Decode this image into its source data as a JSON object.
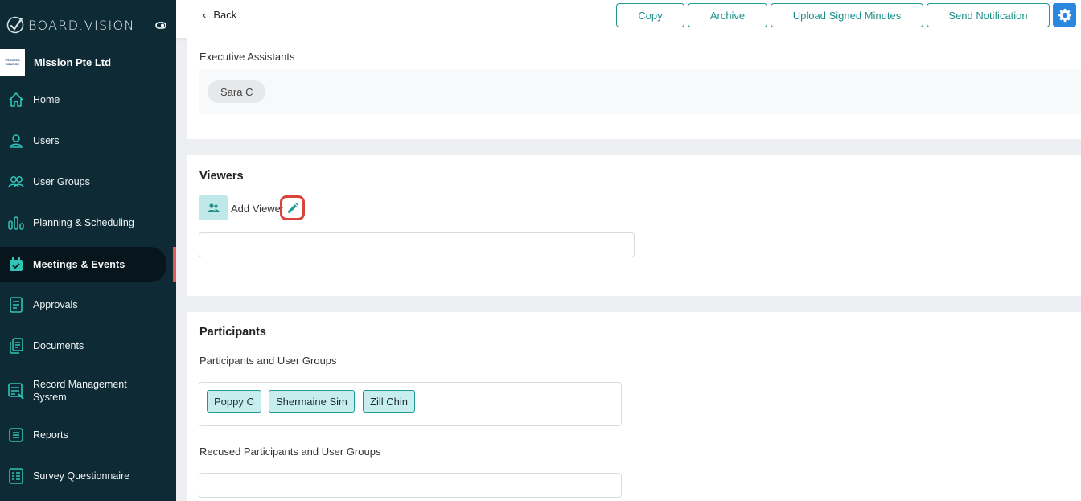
{
  "brand": {
    "name": "BOARD.VISION"
  },
  "org": {
    "logo_lines": [
      "TRUSTED",
      "SOURCE"
    ],
    "name": "Mission Pte Ltd"
  },
  "nav": {
    "items": [
      {
        "label": "Home",
        "icon": "home-icon"
      },
      {
        "label": "Users",
        "icon": "user-icon"
      },
      {
        "label": "User Groups",
        "icon": "users-icon"
      },
      {
        "label": "Planning & Scheduling",
        "icon": "bar-chart-icon"
      },
      {
        "label": "Meetings & Events",
        "icon": "calendar-icon",
        "active": true
      },
      {
        "label": "Approvals",
        "icon": "document-icon"
      },
      {
        "label": "Documents",
        "icon": "documents-icon"
      },
      {
        "label": "Record Management System",
        "icon": "record-icon"
      },
      {
        "label": "Reports",
        "icon": "list-icon"
      },
      {
        "label": "Survey Questionnaire",
        "icon": "survey-icon"
      }
    ]
  },
  "header": {
    "back_label": "Back",
    "buttons": {
      "copy": "Copy",
      "archive": "Archive",
      "upload": "Upload Signed Minutes",
      "notify": "Send Notification"
    }
  },
  "executive_assistants": {
    "label": "Executive Assistants",
    "chips": [
      "Sara C"
    ]
  },
  "viewers": {
    "title": "Viewers",
    "add_label": "Add Viewer"
  },
  "participants": {
    "title": "Participants",
    "list_label": "Participants and User Groups",
    "chips": [
      "Poppy C",
      "Shermaine Sim",
      "Zill Chin"
    ],
    "recused_label": "Recused Participants and User Groups"
  },
  "colors": {
    "sidebar": "#0e2a35",
    "accent": "#1f9a95",
    "active_marker": "#e25b5b",
    "highlight": "#d9433a",
    "settings": "#2a86de"
  }
}
